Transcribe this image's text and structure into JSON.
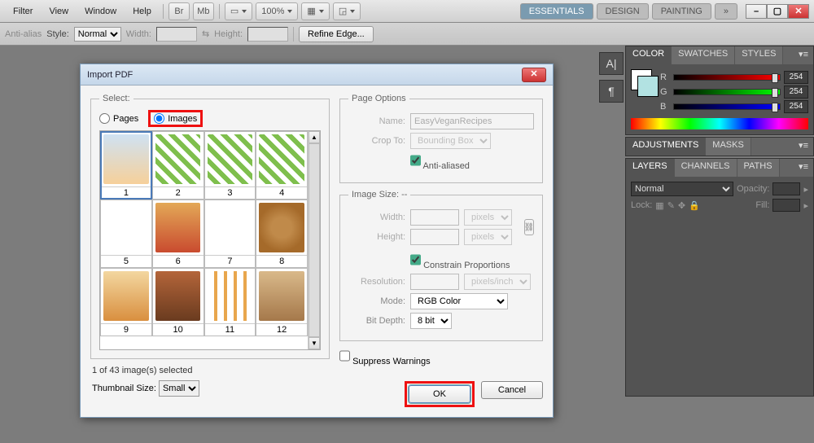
{
  "menu": {
    "items": [
      "Filter",
      "View",
      "Window",
      "Help"
    ],
    "zoom": "100%",
    "workspaces": [
      "ESSENTIALS",
      "DESIGN",
      "PAINTING"
    ]
  },
  "toolbtn": {
    "br": "Br",
    "mb": "Mb"
  },
  "opt": {
    "antialias": "Anti-alias",
    "style": "Style:",
    "style_val": "Normal",
    "width": "Width:",
    "height": "Height:",
    "refine": "Refine Edge..."
  },
  "dialog": {
    "title": "Import PDF",
    "select_legend": "Select:",
    "pages": "Pages",
    "images": "Images",
    "status": "1 of 43 image(s) selected",
    "thumb_label": "Thumbnail Size:",
    "thumb_val": "Small",
    "thumbs": [
      {
        "n": "1",
        "bg": "linear-gradient(#cfe2f3,#f6d09a)"
      },
      {
        "n": "2",
        "bg": "repeating-linear-gradient(45deg,#fff 0 6px,#7fbf4d 6px 12px)"
      },
      {
        "n": "3",
        "bg": "repeating-linear-gradient(45deg,#fff 0 6px,#7fbf4d 6px 12px)"
      },
      {
        "n": "4",
        "bg": "repeating-linear-gradient(45deg,#fff 0 6px,#7fbf4d 6px 12px)"
      },
      {
        "n": "5",
        "bg": "#fff"
      },
      {
        "n": "6",
        "bg": "linear-gradient(#e3a857,#c94b2f)"
      },
      {
        "n": "7",
        "bg": "#fff"
      },
      {
        "n": "8",
        "bg": "radial-gradient(circle,#c08a4a 30%,#a56a2a 70%)"
      },
      {
        "n": "9",
        "bg": "linear-gradient(#f3d7a0,#d98f3f)"
      },
      {
        "n": "10",
        "bg": "linear-gradient(#b4653a,#6a3b1f)"
      },
      {
        "n": "11",
        "bg": "repeating-linear-gradient(90deg,#fff 0 8px,#e8a64d 8px 12px)"
      },
      {
        "n": "12",
        "bg": "linear-gradient(#d9b98a,#a5784a)"
      }
    ],
    "page_options": {
      "legend": "Page Options",
      "name": "Name:",
      "name_val": "EasyVeganRecipes",
      "crop": "Crop To:",
      "crop_val": "Bounding Box",
      "antialias": "Anti-aliased"
    },
    "image_size": {
      "legend": "Image Size: --",
      "width": "Width:",
      "height": "Height:",
      "unit": "pixels",
      "constrain": "Constrain Proportions",
      "resolution": "Resolution:",
      "res_unit": "pixels/inch",
      "mode": "Mode:",
      "mode_val": "RGB Color",
      "bitdepth": "Bit Depth:",
      "bitdepth_val": "8 bit"
    },
    "suppress": "Suppress Warnings",
    "ok": "OK",
    "cancel": "Cancel"
  },
  "panels": {
    "color": {
      "tabs": [
        "COLOR",
        "SWATCHES",
        "STYLES"
      ],
      "r": "R",
      "g": "G",
      "b": "B",
      "val": "254"
    },
    "adjust": {
      "tabs": [
        "ADJUSTMENTS",
        "MASKS"
      ]
    },
    "layers": {
      "tabs": [
        "LAYERS",
        "CHANNELS",
        "PATHS"
      ],
      "blend": "Normal",
      "opacity": "Opacity:",
      "fill": "Fill:",
      "lock": "Lock:"
    }
  },
  "mini": {
    "a": "A|",
    "para": "¶"
  }
}
